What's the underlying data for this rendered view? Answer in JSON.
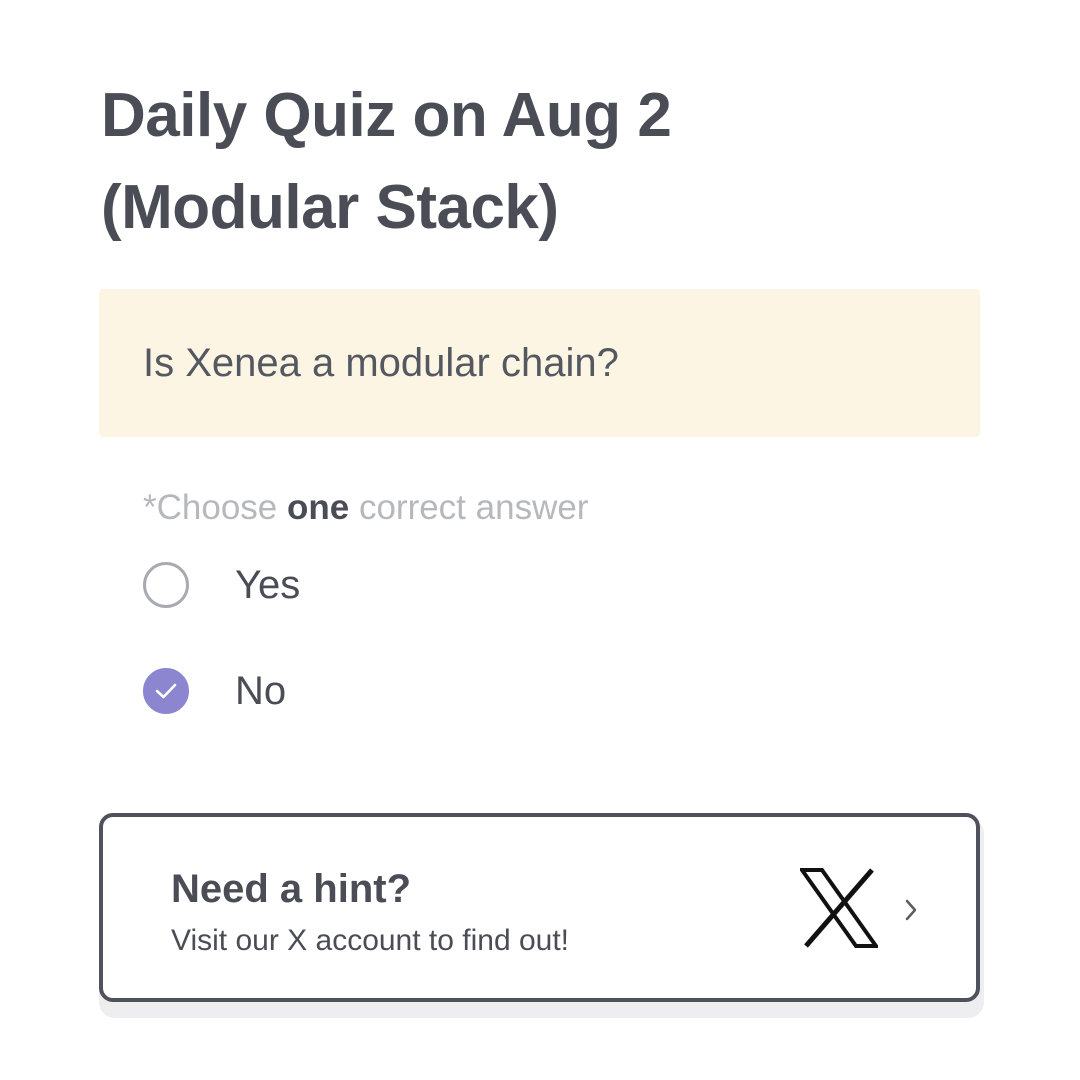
{
  "quiz": {
    "title_line1": "Daily Quiz on Aug 2",
    "title_line2": "(Modular Stack)",
    "question": "Is Xenea a modular chain?",
    "instruction_prefix": "*Choose ",
    "instruction_emphasis": "one",
    "instruction_suffix": " correct answer",
    "options": [
      {
        "label": "Yes",
        "selected": false
      },
      {
        "label": "No",
        "selected": true
      }
    ],
    "accent_color": "#8b86cf",
    "question_bg_color": "#fdf5e3"
  },
  "hint": {
    "title": "Need a hint?",
    "subtitle": "Visit our X account to find out!",
    "icon": "x-logo-icon",
    "arrow_icon": "chevron-right-icon"
  }
}
